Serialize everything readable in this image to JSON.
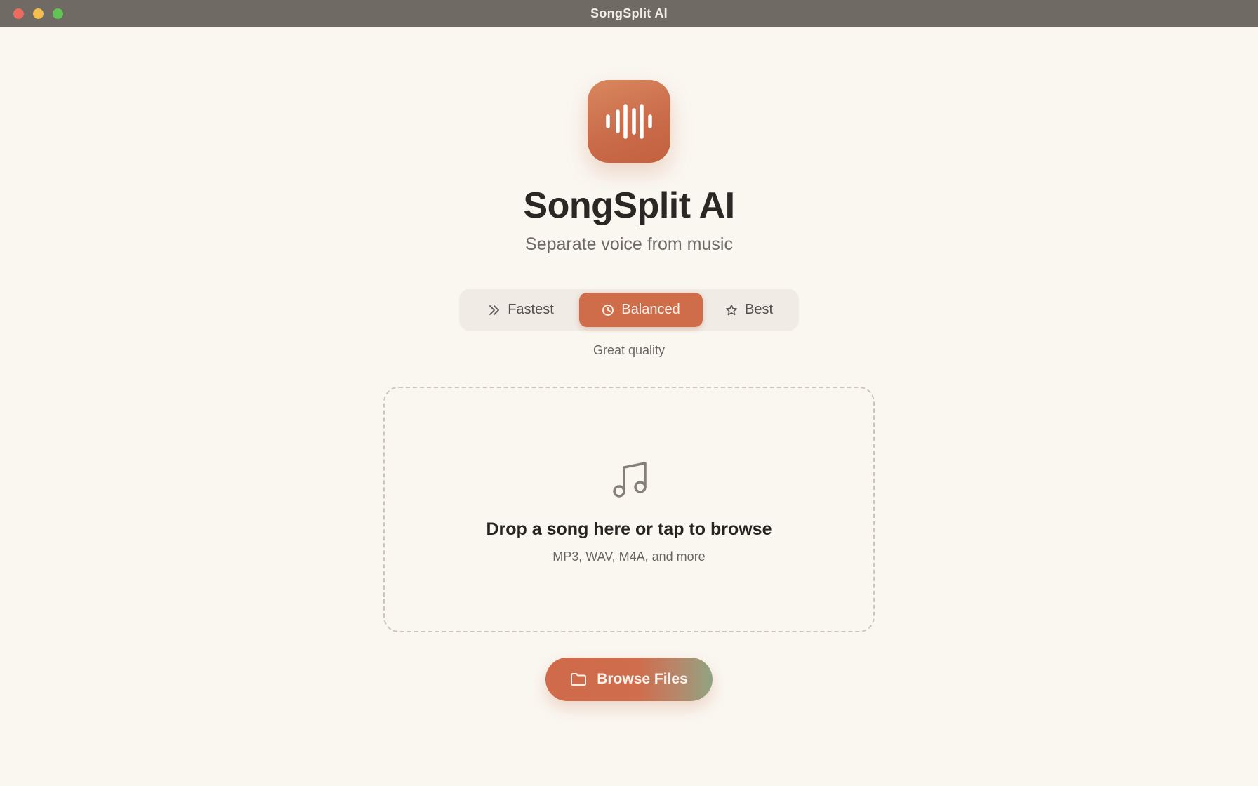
{
  "window": {
    "title": "SongSplit AI"
  },
  "app": {
    "icon": "waveform-icon",
    "title": "SongSplit AI",
    "subtitle": "Separate voice from music"
  },
  "quality_modes": {
    "options": [
      {
        "label": "Fastest",
        "icon": "double-chevron-right-icon",
        "selected": false
      },
      {
        "label": "Balanced",
        "icon": "clock-icon",
        "selected": true
      },
      {
        "label": "Best",
        "icon": "star-icon",
        "selected": false
      }
    ],
    "caption": "Great quality"
  },
  "dropzone": {
    "icon": "music-note-icon",
    "title": "Drop a song here or tap to browse",
    "subtitle": "MP3, WAV, M4A, and more"
  },
  "browse_button": {
    "label": "Browse Files",
    "icon": "folder-icon"
  },
  "colors": {
    "background": "#faf7f1",
    "titlebar": "#6f6a63",
    "accent": "#cf6d4b",
    "accent_green": "#8fa481",
    "text_primary": "#2a2724",
    "text_secondary": "#6b6661"
  }
}
